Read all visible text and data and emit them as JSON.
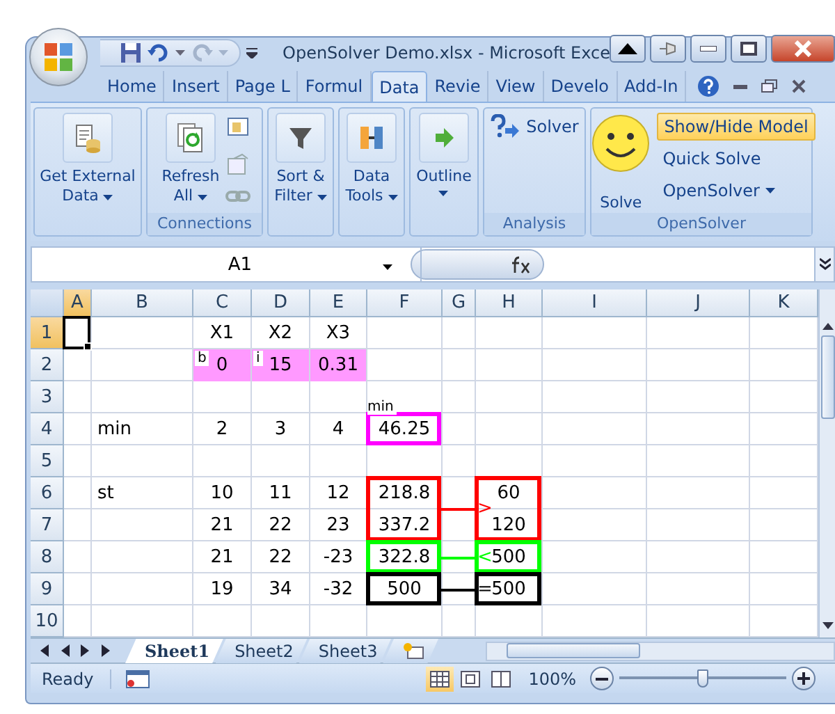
{
  "window": {
    "title": "OpenSolver Demo.xlsx - Microsoft Exce"
  },
  "ribbon_tabs": [
    {
      "label": "Home",
      "selected": false
    },
    {
      "label": "Insert",
      "selected": false
    },
    {
      "label": "Page L",
      "selected": false
    },
    {
      "label": "Formul",
      "selected": false
    },
    {
      "label": "Data",
      "selected": true
    },
    {
      "label": "Revie",
      "selected": false
    },
    {
      "label": "View",
      "selected": false
    },
    {
      "label": "Develo",
      "selected": false
    },
    {
      "label": "Add-In",
      "selected": false
    }
  ],
  "ribbon_groups": [
    {
      "buttons": [
        {
          "kind": "large",
          "label": "Get External\nData",
          "dropdown": true
        }
      ]
    },
    {
      "label": "Connections",
      "buttons": [
        {
          "kind": "large",
          "label": "Refresh\nAll",
          "dropdown": true
        },
        {
          "kind": "icons"
        }
      ]
    },
    {
      "buttons": [
        {
          "kind": "large",
          "label": "Sort &\nFilter",
          "dropdown": true
        }
      ]
    },
    {
      "buttons": [
        {
          "kind": "large",
          "label": "Data\nTools",
          "dropdown": true
        }
      ]
    },
    {
      "buttons": [
        {
          "kind": "large",
          "label": "Outline",
          "dropdown": true
        }
      ]
    },
    {
      "label": "Analysis",
      "buttons": [
        {
          "kind": "small",
          "label": "Solver"
        }
      ]
    },
    {
      "label": "OpenSolver",
      "buttons": [
        {
          "kind": "large",
          "label": "Solve",
          "dropdown": false
        },
        {
          "kind": "stack",
          "items": [
            {
              "label": "Show/Hide Model",
              "highlighted": true,
              "dropdown": false
            },
            {
              "label": "Quick Solve",
              "highlighted": false,
              "dropdown": false
            },
            {
              "label": "OpenSolver",
              "highlighted": false,
              "dropdown": true
            }
          ]
        }
      ]
    }
  ],
  "name_box": "A1",
  "columns": [
    {
      "label": "A",
      "selected": true
    },
    {
      "label": "B",
      "selected": false
    },
    {
      "label": "C",
      "selected": false
    },
    {
      "label": "D",
      "selected": false
    },
    {
      "label": "E",
      "selected": false
    },
    {
      "label": "F",
      "selected": false
    },
    {
      "label": "G",
      "selected": false
    },
    {
      "label": "H",
      "selected": false
    },
    {
      "label": "I",
      "selected": false
    },
    {
      "label": "J",
      "selected": false
    },
    {
      "label": "K",
      "selected": false
    }
  ],
  "rows": [
    {
      "label": "1",
      "selected": true,
      "cells": [
        {
          "active": true
        },
        null,
        {
          "text": "X1"
        },
        {
          "text": "X2"
        },
        {
          "text": "X3"
        },
        null,
        null,
        null,
        null,
        null,
        null
      ]
    },
    {
      "label": "2",
      "selected": false,
      "cells": [
        null,
        null,
        {
          "text": "0",
          "color": "#ff99ff",
          "tag": "b"
        },
        {
          "text": "15",
          "color": "#ff99ff",
          "tag": "i"
        },
        {
          "text": "0.31",
          "color": "#ff99ff"
        },
        null,
        null,
        null,
        null,
        null,
        null
      ]
    },
    {
      "label": "3",
      "selected": false,
      "cells": [
        null,
        null,
        null,
        null,
        null,
        null,
        null,
        null,
        null,
        null,
        null
      ]
    },
    {
      "label": "4",
      "selected": false,
      "cells": [
        null,
        {
          "text": "min"
        },
        {
          "text": "2"
        },
        {
          "text": "3"
        },
        {
          "text": "4"
        },
        {
          "text": "46.25",
          "box": {
            "color": "#ff00ff",
            "label": "min"
          }
        },
        null,
        null,
        null,
        null,
        null
      ]
    },
    {
      "label": "5",
      "selected": false,
      "cells": [
        null,
        null,
        null,
        null,
        null,
        null,
        null,
        null,
        null,
        null,
        null
      ]
    },
    {
      "label": "6",
      "selected": false,
      "cells": [
        null,
        {
          "text": "st"
        },
        {
          "text": "10"
        },
        {
          "text": "11"
        },
        {
          "text": "12"
        },
        {
          "text": "218.8",
          "box": {
            "color": "#ff0000"
          },
          "link": {
            "color": "#ff0000",
            "sense": ">"
          }
        },
        null,
        {
          "text": "60",
          "box": {
            "color": "#ff0000"
          }
        },
        null,
        null,
        null
      ]
    },
    {
      "label": "7",
      "selected": false,
      "cells": [
        null,
        null,
        {
          "text": "21"
        },
        {
          "text": "22"
        },
        {
          "text": "23"
        },
        {
          "text": "337.2",
          "box": {
            "color": "#ff0000"
          }
        },
        null,
        {
          "text": "120",
          "box": {
            "color": "#ff0000"
          }
        },
        null,
        null,
        null
      ]
    },
    {
      "label": "8",
      "selected": false,
      "cells": [
        null,
        null,
        {
          "text": "21"
        },
        {
          "text": "22"
        },
        {
          "text": "-23"
        },
        {
          "text": "322.8",
          "box": {
            "color": "#00ff00"
          },
          "link": {
            "color": "#00ff00",
            "sense": "<"
          }
        },
        null,
        {
          "text": "500",
          "box": {
            "color": "#00ff00"
          }
        },
        null,
        null,
        null
      ]
    },
    {
      "label": "9",
      "selected": false,
      "cells": [
        null,
        null,
        {
          "text": "19"
        },
        {
          "text": "34"
        },
        {
          "text": "-32"
        },
        {
          "text": "500",
          "box": {
            "color": "#000000"
          },
          "link": {
            "color": "#000000",
            "sense": "="
          }
        },
        null,
        {
          "text": "500",
          "box": {
            "color": "#000000"
          }
        },
        null,
        null,
        null
      ]
    },
    {
      "label": "10",
      "selected": false,
      "cells": [
        null,
        null,
        null,
        null,
        null,
        null,
        null,
        null,
        null,
        null,
        null
      ]
    }
  ],
  "sheet_tabs": [
    {
      "label": "Sheet1",
      "selected": true
    },
    {
      "label": "Sheet2",
      "selected": false
    },
    {
      "label": "Sheet3",
      "selected": false
    }
  ],
  "status_bar": {
    "status": "Ready",
    "zoom": "100%",
    "zoom_level": {
      "level": 0.5
    },
    "views": [
      {
        "selected": true
      },
      {
        "selected": false
      },
      {
        "selected": false
      }
    ]
  }
}
